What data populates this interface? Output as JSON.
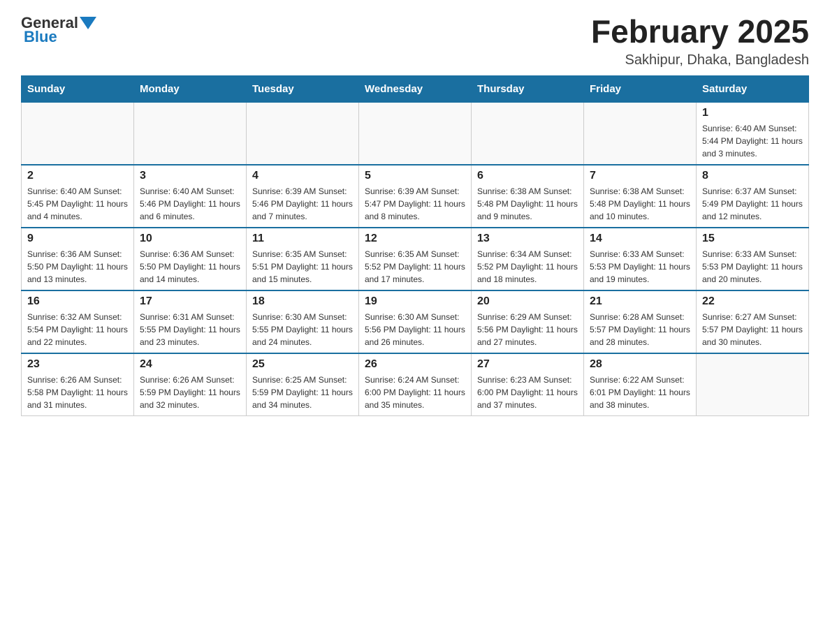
{
  "header": {
    "logo": {
      "general": "General",
      "blue": "Blue"
    },
    "title": "February 2025",
    "location": "Sakhipur, Dhaka, Bangladesh"
  },
  "days_of_week": [
    "Sunday",
    "Monday",
    "Tuesday",
    "Wednesday",
    "Thursday",
    "Friday",
    "Saturday"
  ],
  "weeks": [
    [
      {
        "day": "",
        "info": ""
      },
      {
        "day": "",
        "info": ""
      },
      {
        "day": "",
        "info": ""
      },
      {
        "day": "",
        "info": ""
      },
      {
        "day": "",
        "info": ""
      },
      {
        "day": "",
        "info": ""
      },
      {
        "day": "1",
        "info": "Sunrise: 6:40 AM\nSunset: 5:44 PM\nDaylight: 11 hours and 3 minutes."
      }
    ],
    [
      {
        "day": "2",
        "info": "Sunrise: 6:40 AM\nSunset: 5:45 PM\nDaylight: 11 hours and 4 minutes."
      },
      {
        "day": "3",
        "info": "Sunrise: 6:40 AM\nSunset: 5:46 PM\nDaylight: 11 hours and 6 minutes."
      },
      {
        "day": "4",
        "info": "Sunrise: 6:39 AM\nSunset: 5:46 PM\nDaylight: 11 hours and 7 minutes."
      },
      {
        "day": "5",
        "info": "Sunrise: 6:39 AM\nSunset: 5:47 PM\nDaylight: 11 hours and 8 minutes."
      },
      {
        "day": "6",
        "info": "Sunrise: 6:38 AM\nSunset: 5:48 PM\nDaylight: 11 hours and 9 minutes."
      },
      {
        "day": "7",
        "info": "Sunrise: 6:38 AM\nSunset: 5:48 PM\nDaylight: 11 hours and 10 minutes."
      },
      {
        "day": "8",
        "info": "Sunrise: 6:37 AM\nSunset: 5:49 PM\nDaylight: 11 hours and 12 minutes."
      }
    ],
    [
      {
        "day": "9",
        "info": "Sunrise: 6:36 AM\nSunset: 5:50 PM\nDaylight: 11 hours and 13 minutes."
      },
      {
        "day": "10",
        "info": "Sunrise: 6:36 AM\nSunset: 5:50 PM\nDaylight: 11 hours and 14 minutes."
      },
      {
        "day": "11",
        "info": "Sunrise: 6:35 AM\nSunset: 5:51 PM\nDaylight: 11 hours and 15 minutes."
      },
      {
        "day": "12",
        "info": "Sunrise: 6:35 AM\nSunset: 5:52 PM\nDaylight: 11 hours and 17 minutes."
      },
      {
        "day": "13",
        "info": "Sunrise: 6:34 AM\nSunset: 5:52 PM\nDaylight: 11 hours and 18 minutes."
      },
      {
        "day": "14",
        "info": "Sunrise: 6:33 AM\nSunset: 5:53 PM\nDaylight: 11 hours and 19 minutes."
      },
      {
        "day": "15",
        "info": "Sunrise: 6:33 AM\nSunset: 5:53 PM\nDaylight: 11 hours and 20 minutes."
      }
    ],
    [
      {
        "day": "16",
        "info": "Sunrise: 6:32 AM\nSunset: 5:54 PM\nDaylight: 11 hours and 22 minutes."
      },
      {
        "day": "17",
        "info": "Sunrise: 6:31 AM\nSunset: 5:55 PM\nDaylight: 11 hours and 23 minutes."
      },
      {
        "day": "18",
        "info": "Sunrise: 6:30 AM\nSunset: 5:55 PM\nDaylight: 11 hours and 24 minutes."
      },
      {
        "day": "19",
        "info": "Sunrise: 6:30 AM\nSunset: 5:56 PM\nDaylight: 11 hours and 26 minutes."
      },
      {
        "day": "20",
        "info": "Sunrise: 6:29 AM\nSunset: 5:56 PM\nDaylight: 11 hours and 27 minutes."
      },
      {
        "day": "21",
        "info": "Sunrise: 6:28 AM\nSunset: 5:57 PM\nDaylight: 11 hours and 28 minutes."
      },
      {
        "day": "22",
        "info": "Sunrise: 6:27 AM\nSunset: 5:57 PM\nDaylight: 11 hours and 30 minutes."
      }
    ],
    [
      {
        "day": "23",
        "info": "Sunrise: 6:26 AM\nSunset: 5:58 PM\nDaylight: 11 hours and 31 minutes."
      },
      {
        "day": "24",
        "info": "Sunrise: 6:26 AM\nSunset: 5:59 PM\nDaylight: 11 hours and 32 minutes."
      },
      {
        "day": "25",
        "info": "Sunrise: 6:25 AM\nSunset: 5:59 PM\nDaylight: 11 hours and 34 minutes."
      },
      {
        "day": "26",
        "info": "Sunrise: 6:24 AM\nSunset: 6:00 PM\nDaylight: 11 hours and 35 minutes."
      },
      {
        "day": "27",
        "info": "Sunrise: 6:23 AM\nSunset: 6:00 PM\nDaylight: 11 hours and 37 minutes."
      },
      {
        "day": "28",
        "info": "Sunrise: 6:22 AM\nSunset: 6:01 PM\nDaylight: 11 hours and 38 minutes."
      },
      {
        "day": "",
        "info": ""
      }
    ]
  ]
}
